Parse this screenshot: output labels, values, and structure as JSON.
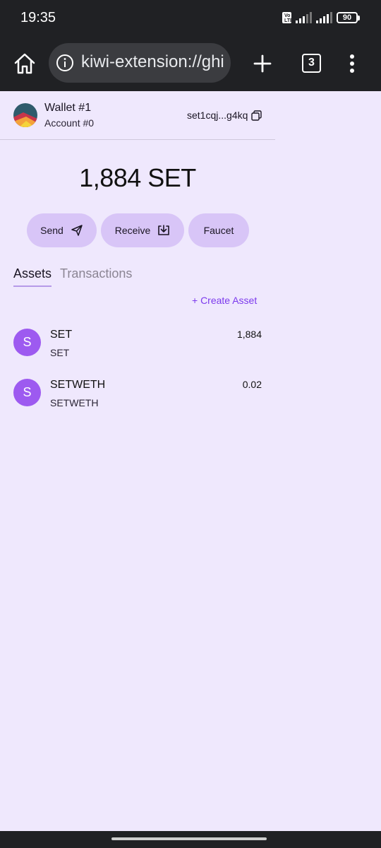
{
  "status_bar": {
    "time": "19:35",
    "volte": "Vo LTE",
    "battery": "90"
  },
  "browser": {
    "url": "kiwi-extension://ghi",
    "tab_count": "3",
    "icons": [
      "home-icon",
      "info-icon",
      "plus-icon",
      "tabs-icon",
      "more-vert-icon"
    ]
  },
  "wallet": {
    "name": "Wallet #1",
    "account": "Account #0",
    "address": "set1cqj...g4kq",
    "balance": "1,884 SET"
  },
  "actions": [
    {
      "label": "Send",
      "icon": "send-icon"
    },
    {
      "label": "Receive",
      "icon": "download-icon"
    },
    {
      "label": "Faucet"
    }
  ],
  "tabs": {
    "assets": "Assets",
    "transactions": "Transactions"
  },
  "create_asset": "+ Create Asset",
  "assets": [
    {
      "letter": "S",
      "symbol": "SET",
      "name": "SET",
      "amount": "1,884"
    },
    {
      "letter": "S",
      "symbol": "SETWETH",
      "name": "SETWETH",
      "amount": "0.02"
    }
  ],
  "colors": {
    "background": "#efe8fd",
    "button": "#d8c5f7",
    "accent": "#7c3aed",
    "asset_icon": "#9d5af0",
    "chrome": "#202124"
  }
}
